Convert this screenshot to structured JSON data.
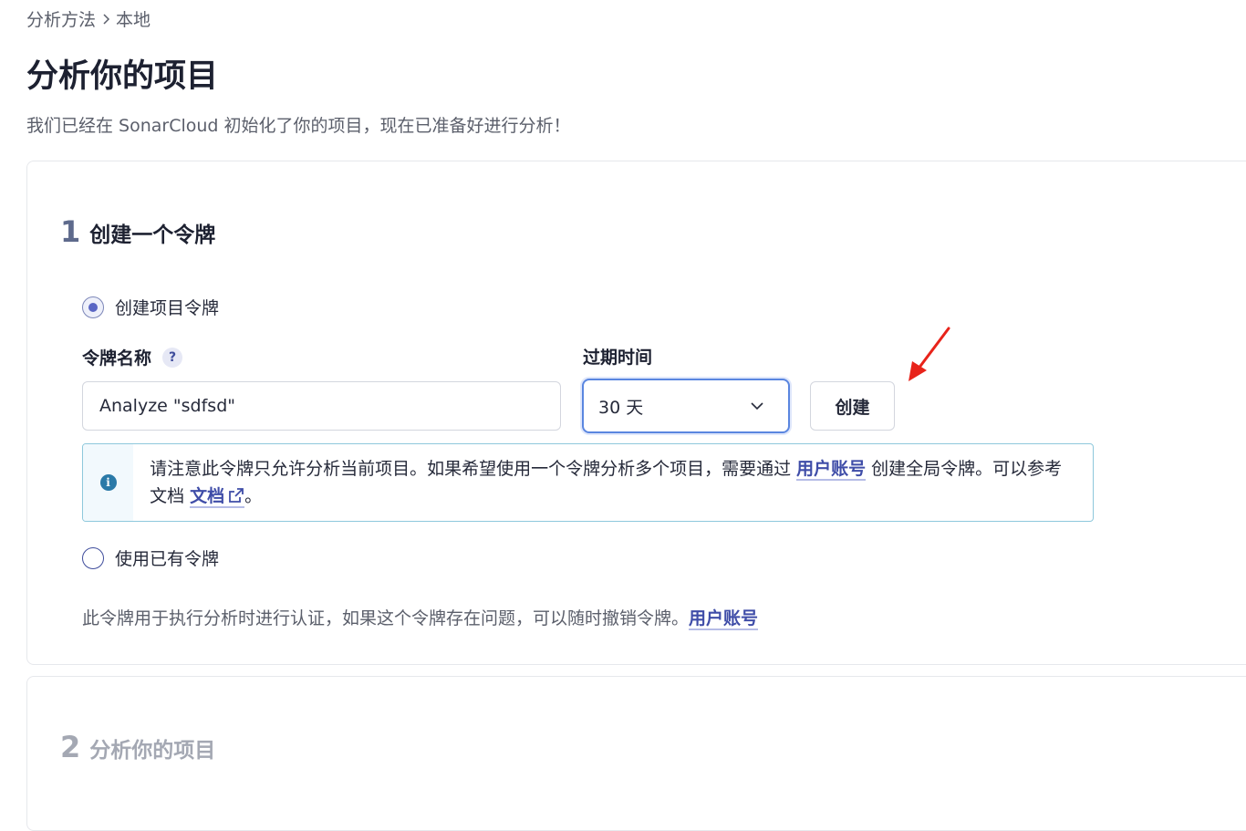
{
  "breadcrumb": {
    "parent": "分析方法",
    "current": "本地"
  },
  "page": {
    "title": "分析你的项目",
    "subtitle": "我们已经在 SonarCloud 初始化了你的项目，现在已准备好进行分析！"
  },
  "step1": {
    "number": "1",
    "title": "创建一个令牌",
    "option_create_label": "创建项目令牌",
    "option_create_selected": true,
    "token_name_label": "令牌名称",
    "help_label": "?",
    "token_name_value": "Analyze \"sdfsd\"",
    "expiry_label": "过期时间",
    "expiry_value": "30 天",
    "create_button": "创建",
    "info": {
      "text_before_link": "请注意此令牌只允许分析当前项目。如果希望使用一个令牌分析多个项目，需要通过 ",
      "account_link": "用户账号",
      "text_middle": " 创建全局令牌。可以参考文档 ",
      "docs_link": "文档",
      "text_end": "。"
    },
    "option_existing_label": "使用已有令牌",
    "footer_text": "此令牌用于执行分析时进行认证，如果这个令牌存在问题，可以随时撤销令牌。",
    "footer_link": "用户账号"
  },
  "step2": {
    "number": "2",
    "title": "分析你的项目"
  },
  "colors": {
    "accent": "#3f4da8",
    "focus_border": "#5a86e0",
    "info_border": "#8ec8dc",
    "arrow": "#e8231a"
  },
  "icons": {
    "breadcrumb_separator": "chevron-right-icon",
    "select": "chevron-down-icon",
    "info": "info-icon",
    "external": "external-link-icon",
    "annotation": "red-arrow-icon"
  }
}
